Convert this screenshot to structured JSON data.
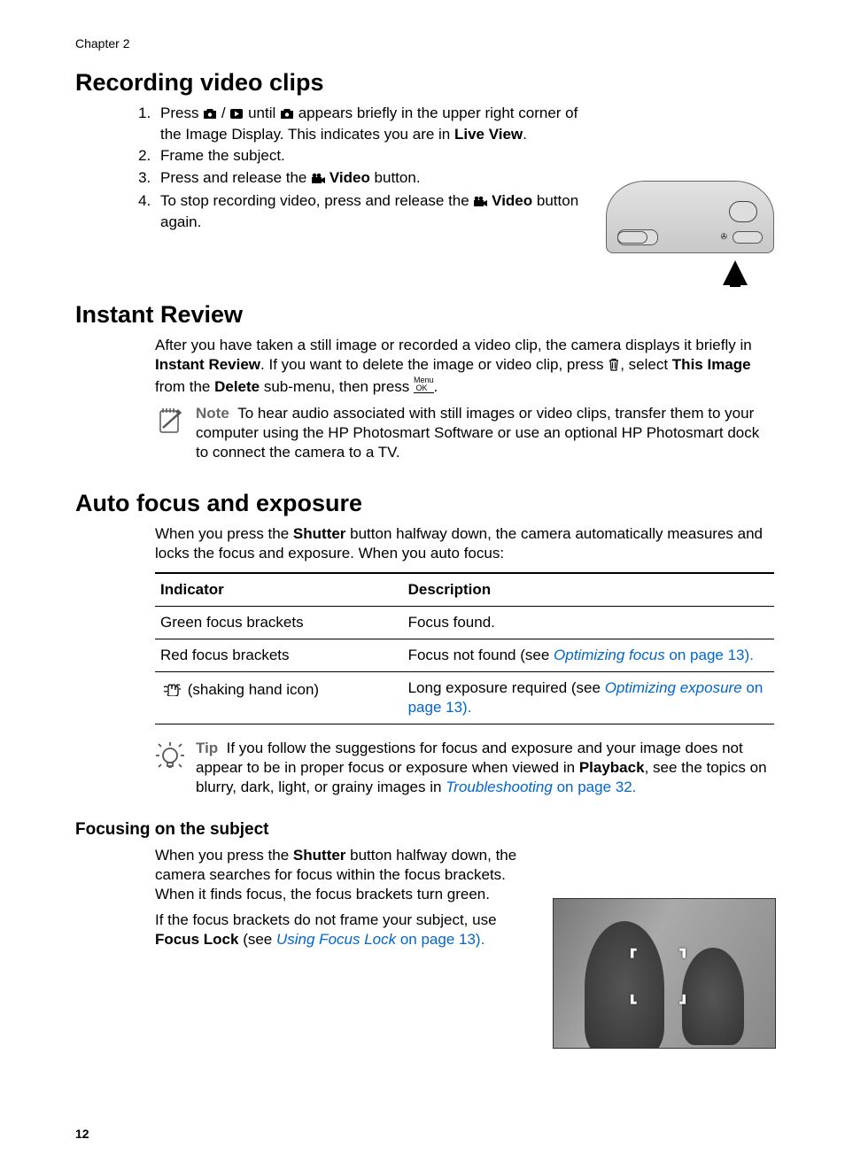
{
  "chapter": "Chapter 2",
  "page_number": "12",
  "sec1": {
    "heading": "Recording video clips",
    "step1_a": "Press ",
    "step1_b": " until ",
    "step1_c": " appears briefly in the upper right corner of the Image Display. This indicates you are in ",
    "step1_bold": "Live View",
    "step1_d": ".",
    "step2": "Frame the subject.",
    "step3_a": "Press and release the ",
    "step3_bold": "Video",
    "step3_b": " button.",
    "step4_a": "To stop recording video, press and release the ",
    "step4_bold": "Video",
    "step4_b": " button again."
  },
  "sec2": {
    "heading": "Instant Review",
    "p1_a": "After you have taken a still image or recorded a video clip, the camera displays it briefly in ",
    "p1_bold1": "Instant Review",
    "p1_b": ". If you want to delete the image or video clip, press ",
    "p1_c": ", select ",
    "p1_bold2": "This Image",
    "p1_d": " from the ",
    "p1_bold3": "Delete",
    "p1_e": " sub-menu, then press ",
    "p1_f": ".",
    "note_label": "Note",
    "note": "To hear audio associated with still images or video clips, transfer them to your computer using the HP Photosmart Software or use an optional HP Photosmart dock to connect the camera to a TV."
  },
  "sec3": {
    "heading": "Auto focus and exposure",
    "intro_a": "When you press the ",
    "intro_bold": "Shutter",
    "intro_b": " button halfway down, the camera automatically measures and locks the focus and exposure. When you auto focus:",
    "th1": "Indicator",
    "th2": "Description",
    "r1c1": "Green focus brackets",
    "r1c2": "Focus found.",
    "r2c1": "Red focus brackets",
    "r2c2_a": "Focus not found (see ",
    "r2c2_link": "Optimizing focus",
    "r2c2_b": " on page 13).",
    "r3c1": " (shaking hand icon)",
    "r3c2_a": "Long exposure required (see ",
    "r3c2_link": "Optimizing exposure",
    "r3c2_b": " on page 13).",
    "tip_label": "Tip",
    "tip_a": "If you follow the suggestions for focus and exposure and your image does not appear to be in proper focus or exposure when viewed in ",
    "tip_bold": "Playback",
    "tip_b": ", see the topics on blurry, dark, light, or grainy images in ",
    "tip_link": "Troubleshooting",
    "tip_c": " on page 32."
  },
  "sec4": {
    "heading": "Focusing on the subject",
    "p1_a": "When you press the ",
    "p1_bold": "Shutter",
    "p1_b": " button halfway down, the camera searches for focus within the focus brackets. When it finds focus, the focus brackets turn green.",
    "p2_a": "If the focus brackets do not frame your subject, use ",
    "p2_bold": "Focus Lock",
    "p2_b": " (see ",
    "p2_link": "Using Focus Lock",
    "p2_c": " on page 13)."
  }
}
